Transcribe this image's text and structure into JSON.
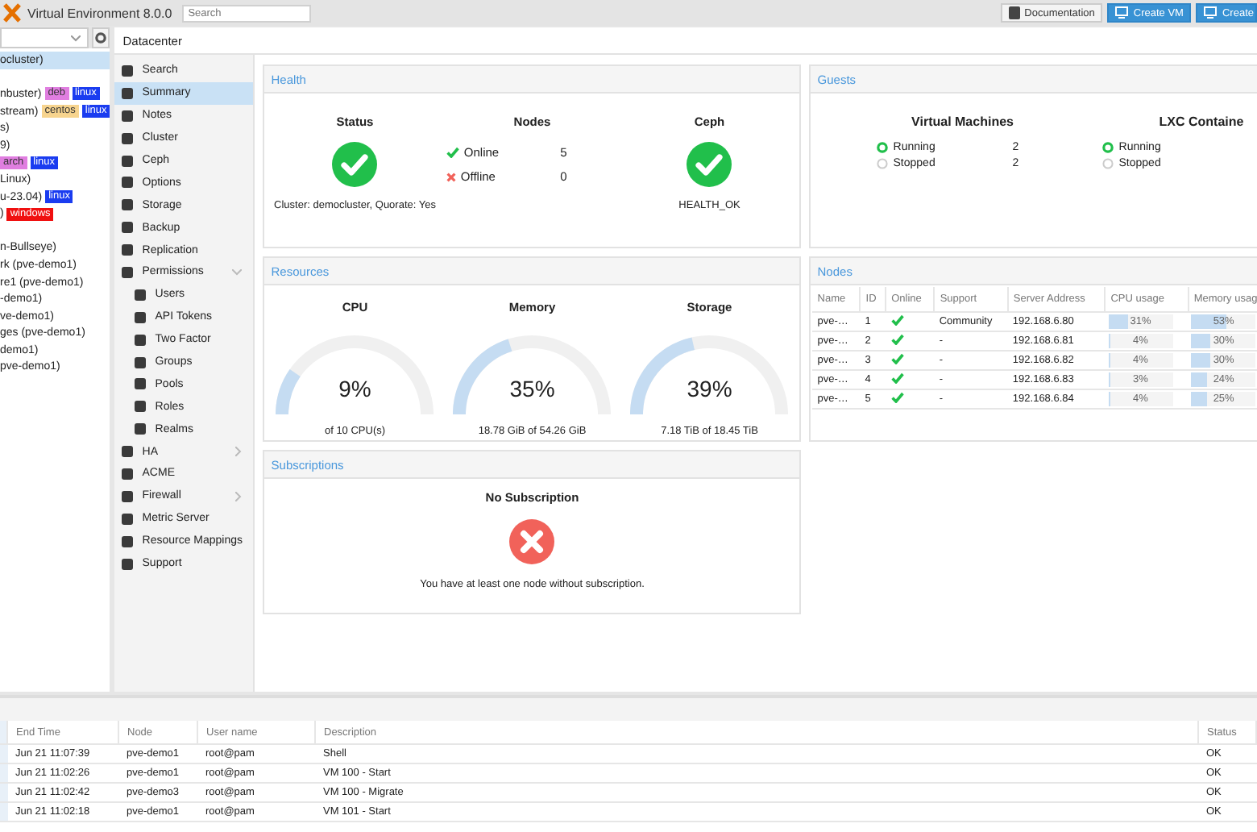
{
  "topbar": {
    "product": "Virtual Environment 8.0.0",
    "search": {
      "placeholder": "Search"
    },
    "buttons": [
      {
        "label": "Documentation",
        "kind": "plain"
      },
      {
        "label": "Create VM",
        "kind": "primary"
      },
      {
        "label": "Create",
        "kind": "primary"
      }
    ]
  },
  "tree": {
    "items": [
      {
        "label": "ocluster)",
        "selected": true
      },
      {
        "label": "nbuster)",
        "selected": false,
        "tags": [
          {
            "text": "deb",
            "color": "#e07ee0"
          },
          {
            "text": "linux",
            "color": "#1a3cf0"
          }
        ]
      },
      {
        "label": "stream)",
        "selected": false,
        "tags": [
          {
            "text": "centos",
            "color": "#f7d48e"
          },
          {
            "text": "linux",
            "color": "#1a3cf0"
          }
        ]
      },
      {
        "label": "s)",
        "selected": false
      },
      {
        "label": "9)",
        "selected": false
      },
      {
        "selected": false,
        "tags": [
          {
            "text": "arch",
            "color": "#e07ee0"
          },
          {
            "text": "linux",
            "color": "#1a3cf0"
          }
        ]
      },
      {
        "label": "Linux)",
        "selected": false
      },
      {
        "label": "u-23.04)",
        "selected": false,
        "tags": [
          {
            "text": "linux",
            "color": "#1a3cf0"
          }
        ]
      },
      {
        "label": ")",
        "selected": false,
        "tags": [
          {
            "text": "windows",
            "color": "#f01010"
          }
        ]
      },
      {
        "label": "n-Bullseye)",
        "selected": false
      },
      {
        "label": "rk (pve-demo1)",
        "selected": false
      },
      {
        "label": "re1 (pve-demo1)",
        "selected": false
      },
      {
        "label": "-demo1)",
        "selected": false
      },
      {
        "label": "ve-demo1)",
        "selected": false
      },
      {
        "label": "ges (pve-demo1)",
        "selected": false
      },
      {
        "label": "demo1)",
        "selected": false
      },
      {
        "label": "pve-demo1)",
        "selected": false
      }
    ]
  },
  "breadcrumb": "Datacenter",
  "nav": {
    "items": [
      {
        "label": "Search",
        "selected": false
      },
      {
        "label": "Summary",
        "selected": true
      },
      {
        "label": "Notes",
        "selected": false
      },
      {
        "label": "Cluster",
        "selected": false
      },
      {
        "label": "Ceph",
        "selected": false
      },
      {
        "label": "Options",
        "selected": false
      },
      {
        "label": "Storage",
        "selected": false
      },
      {
        "label": "Backup",
        "selected": false
      },
      {
        "label": "Replication",
        "selected": false
      },
      {
        "label": "Permissions",
        "selected": false,
        "expanded": true,
        "children": [
          {
            "label": "Users",
            "selected": false
          },
          {
            "label": "API Tokens",
            "selected": false
          },
          {
            "label": "Two Factor",
            "selected": false
          },
          {
            "label": "Groups",
            "selected": false
          },
          {
            "label": "Pools",
            "selected": false
          },
          {
            "label": "Roles",
            "selected": false
          },
          {
            "label": "Realms",
            "selected": false
          }
        ]
      },
      {
        "label": "HA",
        "selected": false,
        "expanded": false
      },
      {
        "label": "ACME",
        "selected": false
      },
      {
        "label": "Firewall",
        "selected": false,
        "expanded": false
      },
      {
        "label": "Metric Server",
        "selected": false
      },
      {
        "label": "Resource Mappings",
        "selected": false
      },
      {
        "label": "Support",
        "selected": false
      }
    ]
  },
  "health": {
    "title": "Health",
    "status": {
      "heading": "Status",
      "ok": true,
      "caption": "Cluster: democluster, Quorate: Yes"
    },
    "nodes": {
      "heading": "Nodes",
      "rows": [
        {
          "kind": "online",
          "label": "Online",
          "count": "5"
        },
        {
          "kind": "offline",
          "label": "Offline",
          "count": "0"
        }
      ]
    },
    "ceph": {
      "heading": "Ceph",
      "ok": true,
      "caption": "HEALTH_OK"
    }
  },
  "guests": {
    "title": "Guests",
    "groups": [
      {
        "heading": "Virtual Machines",
        "rows": [
          {
            "kind": "running",
            "label": "Running",
            "count": "2"
          },
          {
            "kind": "stopped",
            "label": "Stopped",
            "count": "2"
          }
        ]
      },
      {
        "heading": "LXC Containe",
        "rows": [
          {
            "kind": "running",
            "label": "Running"
          },
          {
            "kind": "stopped",
            "label": "Stopped"
          }
        ]
      }
    ]
  },
  "resources": {
    "title": "Resources",
    "gauges": [
      {
        "heading": "CPU",
        "value": "9%",
        "level": 0.09,
        "caption": "of 10 CPU(s)"
      },
      {
        "heading": "Memory",
        "value": "35%",
        "level": 0.35,
        "caption": "18.78 GiB of 54.26 GiB"
      },
      {
        "heading": "Storage",
        "value": "39%",
        "level": 0.39,
        "caption": "7.18 TiB of 18.45 TiB"
      }
    ]
  },
  "nodes": {
    "title": "Nodes",
    "columns": [
      "Name",
      "ID",
      "Online",
      "Support",
      "Server Address",
      "CPU usage",
      "Memory usag"
    ],
    "rows": [
      {
        "name": "pve-…",
        "id": "1",
        "online": true,
        "support": "Community",
        "address": "192.168.6.80",
        "cpu": {
          "text": "31%",
          "level": 0.31
        },
        "memory": {
          "text": "53%",
          "level": 0.53
        }
      },
      {
        "name": "pve-…",
        "id": "2",
        "online": true,
        "support": "-",
        "address": "192.168.6.81",
        "cpu": {
          "text": "4%",
          "level": 0.04
        },
        "memory": {
          "text": "30%",
          "level": 0.3
        }
      },
      {
        "name": "pve-…",
        "id": "3",
        "online": true,
        "support": "-",
        "address": "192.168.6.82",
        "cpu": {
          "text": "4%",
          "level": 0.04
        },
        "memory": {
          "text": "30%",
          "level": 0.3
        }
      },
      {
        "name": "pve-…",
        "id": "4",
        "online": true,
        "support": "-",
        "address": "192.168.6.83",
        "cpu": {
          "text": "3%",
          "level": 0.03
        },
        "memory": {
          "text": "24%",
          "level": 0.24
        }
      },
      {
        "name": "pve-…",
        "id": "5",
        "online": true,
        "support": "-",
        "address": "192.168.6.84",
        "cpu": {
          "text": "4%",
          "level": 0.04
        },
        "memory": {
          "text": "25%",
          "level": 0.25
        }
      }
    ]
  },
  "subscriptions": {
    "title": "Subscriptions",
    "heading": "No Subscription",
    "ok": false,
    "message": "You have at least one node without subscription."
  },
  "tasks": {
    "columns": [
      "End Time",
      "Node",
      "User name",
      "Description",
      "Status"
    ],
    "rows": [
      [
        "Jun 21 11:07:39",
        "pve-demo1",
        "root@pam",
        "Shell",
        "OK"
      ],
      [
        "Jun 21 11:02:26",
        "pve-demo1",
        "root@pam",
        "VM 100 - Start",
        "OK"
      ],
      [
        "Jun 21 11:02:42",
        "pve-demo3",
        "root@pam",
        "VM 100 - Migrate",
        "OK"
      ],
      [
        "Jun 21 11:02:18",
        "pve-demo1",
        "root@pam",
        "VM 101 - Start",
        "OK"
      ]
    ]
  }
}
